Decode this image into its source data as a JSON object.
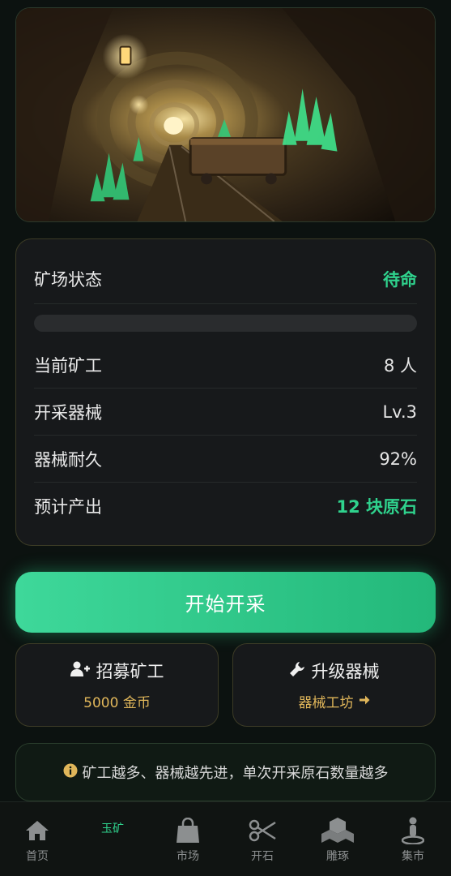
{
  "status_card": {
    "state_label": "矿场状态",
    "state_value": "待命",
    "progress": 0,
    "miners_label": "当前矿工",
    "miners_value": "8 人",
    "equipment_label": "开采器械",
    "equipment_value": "Lv.3",
    "durability_label": "器械耐久",
    "durability_value": "92%",
    "output_label": "预计产出",
    "output_value": "12 块原石"
  },
  "actions": {
    "start_label": "开始开采",
    "recruit_label": "招募矿工",
    "recruit_cost": "5000 金币",
    "upgrade_label": "升级器械",
    "upgrade_link": "器械工坊"
  },
  "tip": {
    "text": "矿工越多、器械越先进，单次开采原石数量越多"
  },
  "nav": {
    "items": [
      {
        "label": "首页",
        "icon": "home-icon"
      },
      {
        "label": "玉矿",
        "icon": "mine-icon"
      },
      {
        "label": "市场",
        "icon": "shopping-bag-icon"
      },
      {
        "label": "开石",
        "icon": "scissors-icon"
      },
      {
        "label": "雕琢",
        "icon": "cubes-icon"
      },
      {
        "label": "集市",
        "icon": "person-pin-icon"
      }
    ]
  },
  "colors": {
    "accent_green": "#2fd28d",
    "gold": "#e0b65a",
    "card_bg": "#17191b",
    "page_bg": "#0c1210"
  }
}
